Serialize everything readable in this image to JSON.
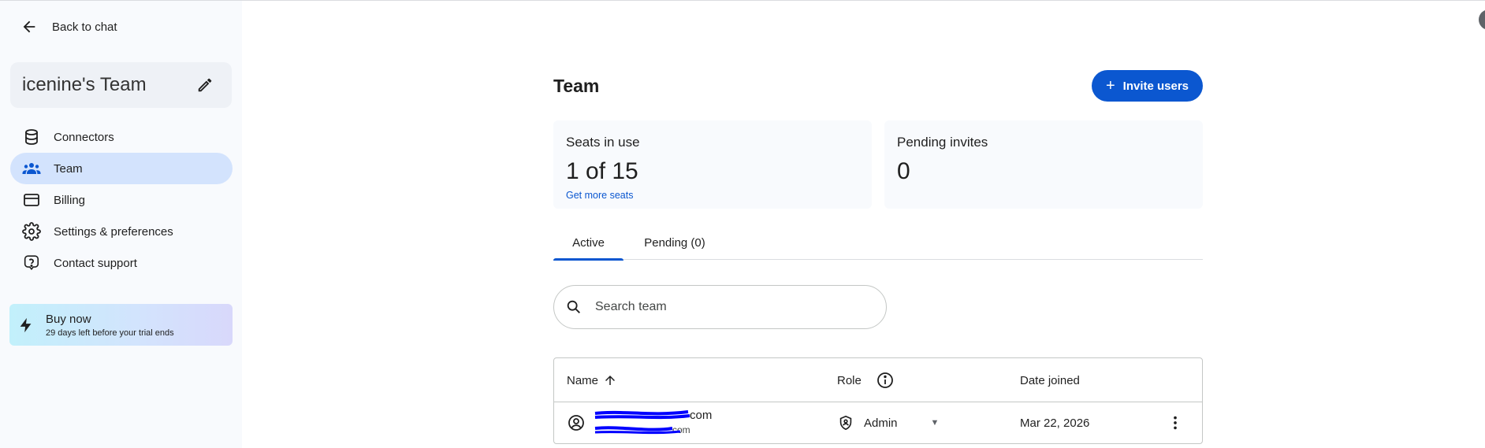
{
  "sidebar": {
    "back_label": "Back to chat",
    "team_name": "icenine's Team",
    "items": [
      {
        "label": "Connectors",
        "icon": "database-icon"
      },
      {
        "label": "Team",
        "icon": "people-icon",
        "active": true
      },
      {
        "label": "Billing",
        "icon": "credit-card-icon"
      },
      {
        "label": "Settings & preferences",
        "icon": "gear-icon"
      },
      {
        "label": "Contact support",
        "icon": "help-icon"
      }
    ],
    "buy": {
      "title": "Buy now",
      "subtitle": "29 days left before your trial ends",
      "icon": "bolt-icon"
    }
  },
  "main": {
    "title": "Team",
    "invite_label": "Invite users",
    "seats": {
      "label": "Seats in use",
      "value": "1 of 15",
      "link": "Get more seats"
    },
    "pending": {
      "label": "Pending invites",
      "value": "0"
    },
    "tabs": [
      {
        "label": "Active",
        "active": true
      },
      {
        "label": "Pending (0)",
        "active": false
      }
    ],
    "search": {
      "placeholder": "Search team",
      "value": ""
    },
    "table": {
      "columns": {
        "name": "Name",
        "role": "Role",
        "date": "Date joined"
      },
      "rows": [
        {
          "email": "com",
          "subtext": "com",
          "role": "Admin",
          "date_joined": "Mar 22, 2026"
        }
      ]
    }
  },
  "colors": {
    "accent": "#0b57d0",
    "active_nav": "#d3e3fd",
    "sidebar_bg": "#f8fafd",
    "redaction": "#0000ff"
  }
}
